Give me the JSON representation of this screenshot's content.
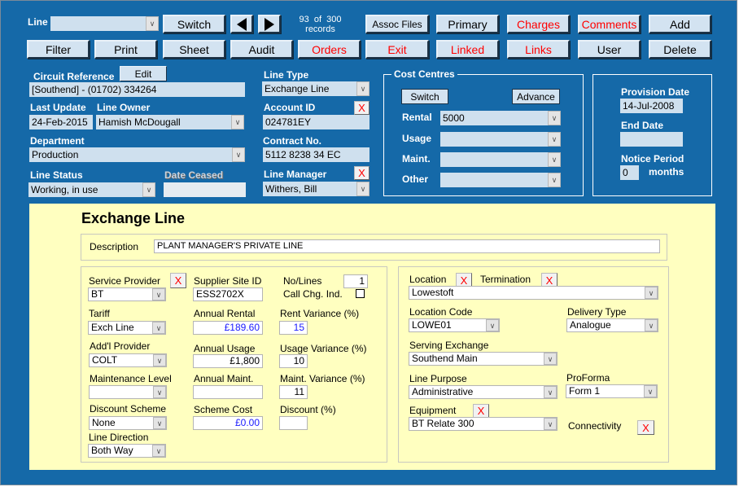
{
  "header": {
    "line_label": "Line",
    "line_value": "",
    "switch": "Switch",
    "prev_icon": "triangle-left",
    "next_icon": "triangle-right",
    "records_line1": "93  of  300",
    "records_line2": "records"
  },
  "toolbar": {
    "row1": [
      "Assoc Files",
      "Primary",
      "Charges",
      "Comments",
      "Add"
    ],
    "row2": [
      "Filter",
      "Print",
      "Sheet",
      "Audit",
      "Orders",
      "Exit",
      "Linked",
      "Links",
      "User",
      "Delete"
    ]
  },
  "colors": {
    "background": "#1569a8",
    "field": "#cfe0ee",
    "panel": "#ffffc0",
    "alert_text": "#ff0000",
    "currency_text": "#1a1aff"
  },
  "form": {
    "circuit_reference_label": "Circuit Reference",
    "edit": "Edit",
    "circuit_reference": "[Southend] - (01702) 334264",
    "last_update_label": "Last Update",
    "last_update": "24-Feb-2015",
    "line_owner_label": "Line Owner",
    "line_owner": "Hamish McDougall",
    "department_label": "Department",
    "department": "Production",
    "line_status_label": "Line Status",
    "line_status": "Working, in use",
    "date_ceased_label": "Date Ceased",
    "date_ceased": "",
    "line_type_label": "Line Type",
    "line_type": "Exchange Line",
    "account_id_label": "Account ID",
    "account_id": "024781EY",
    "contract_no_label": "Contract No.",
    "contract_no": "5112 8238 34 EC",
    "line_manager_label": "Line Manager",
    "line_manager": "Withers, Bill",
    "clear": "X"
  },
  "cost_centres": {
    "title": "Cost Centres",
    "switch": "Switch",
    "advance": "Advance",
    "rows": [
      {
        "label": "Rental",
        "value": "5000"
      },
      {
        "label": "Usage",
        "value": ""
      },
      {
        "label": "Maint.",
        "value": ""
      },
      {
        "label": "Other",
        "value": ""
      }
    ]
  },
  "dates": {
    "provision_label": "Provision Date",
    "provision": "14-Jul-2008",
    "end_label": "End Date",
    "end": "",
    "notice_label": "Notice Period",
    "notice": "0",
    "months": "months"
  },
  "panel": {
    "title": "Exchange Line",
    "description_label": "Description",
    "description": "PLANT MANAGER'S PRIVATE LINE",
    "service_provider_label": "Service Provider",
    "service_provider": "BT",
    "supplier_site_label": "Supplier Site ID",
    "supplier_site": "ESS2702X",
    "no_lines_label": "No/Lines",
    "no_lines": "1",
    "call_chg_label": "Call Chg. Ind.",
    "call_chg_checked": false,
    "tariff_label": "Tariff",
    "tariff": "Exch Line",
    "annual_rental_label": "Annual Rental",
    "annual_rental": "£189.60",
    "rent_variance_label": "Rent Variance (%)",
    "rent_variance": "15",
    "addl_provider_label": "Add'l Provider",
    "addl_provider": "COLT",
    "annual_usage_label": "Annual Usage",
    "annual_usage": "£1,800",
    "usage_variance_label": "Usage Variance (%)",
    "usage_variance": "10",
    "maintenance_level_label": "Maintenance Level",
    "maintenance_level": "",
    "annual_maint_label": "Annual Maint.",
    "annual_maint": "",
    "maint_variance_label": "Maint. Variance (%)",
    "maint_variance": "11",
    "discount_scheme_label": "Discount Scheme",
    "discount_scheme": "None",
    "scheme_cost_label": "Scheme Cost",
    "scheme_cost": "£0.00",
    "discount_label": "Discount (%)",
    "discount": "",
    "line_direction_label": "Line Direction",
    "line_direction": "Both Way",
    "location_label": "Location",
    "termination_label": "Termination",
    "location": "Lowestoft",
    "location_code_label": "Location Code",
    "location_code": "LOWE01",
    "delivery_type_label": "Delivery Type",
    "delivery_type": "Analogue",
    "serving_exchange_label": "Serving Exchange",
    "serving_exchange": "Southend Main",
    "line_purpose_label": "Line Purpose",
    "line_purpose": "Administrative",
    "proforma_label": "ProForma",
    "proforma": "Form 1",
    "equipment_label": "Equipment",
    "equipment": "BT Relate 300",
    "connectivity_label": "Connectivity"
  }
}
